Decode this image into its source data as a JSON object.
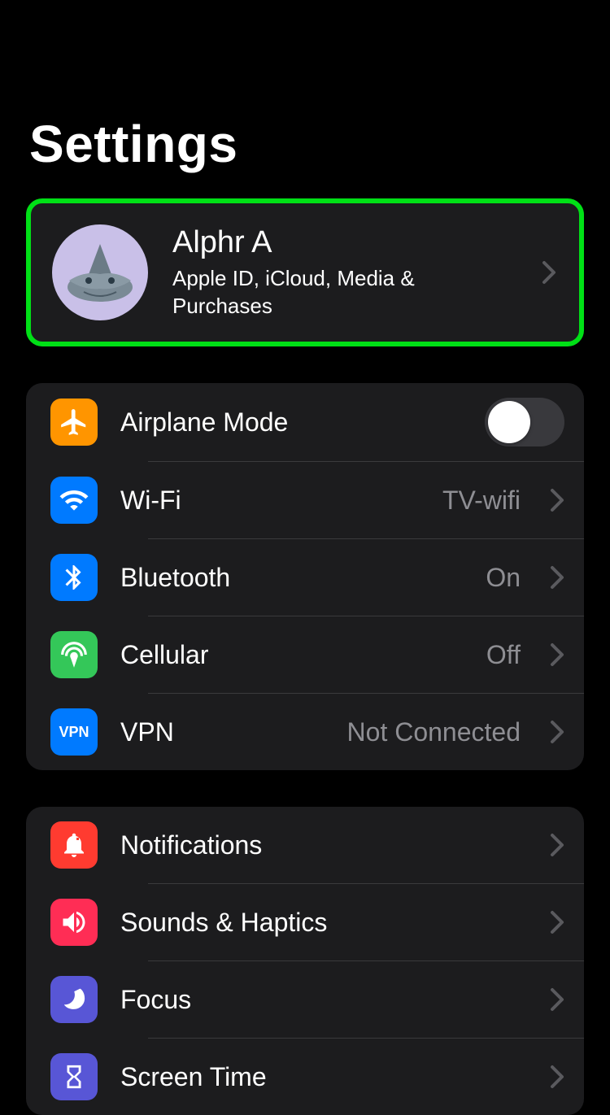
{
  "header": {
    "title": "Settings"
  },
  "account": {
    "name": "Alphr A",
    "subtitle": "Apple ID, iCloud, Media & Purchases",
    "highlighted": true
  },
  "groups": [
    {
      "items": [
        {
          "id": "airplane",
          "label": "Airplane Mode",
          "icon": "airplane-icon",
          "icon_color": "orange",
          "control": "toggle",
          "toggle_on": false
        },
        {
          "id": "wifi",
          "label": "Wi-Fi",
          "icon": "wifi-icon",
          "icon_color": "blue",
          "control": "disclosure",
          "value": "TV-wifi"
        },
        {
          "id": "bluetooth",
          "label": "Bluetooth",
          "icon": "bluetooth-icon",
          "icon_color": "blue",
          "control": "disclosure",
          "value": "On"
        },
        {
          "id": "cellular",
          "label": "Cellular",
          "icon": "cellular-icon",
          "icon_color": "green",
          "control": "disclosure",
          "value": "Off"
        },
        {
          "id": "vpn",
          "label": "VPN",
          "icon": "vpn-icon",
          "icon_color": "blue",
          "control": "disclosure",
          "value": "Not Connected"
        }
      ]
    },
    {
      "items": [
        {
          "id": "notifications",
          "label": "Notifications",
          "icon": "bell-icon",
          "icon_color": "red",
          "control": "disclosure",
          "value": ""
        },
        {
          "id": "sounds",
          "label": "Sounds & Haptics",
          "icon": "speaker-icon",
          "icon_color": "pink",
          "control": "disclosure",
          "value": ""
        },
        {
          "id": "focus",
          "label": "Focus",
          "icon": "moon-icon",
          "icon_color": "indigo",
          "control": "disclosure",
          "value": ""
        },
        {
          "id": "screentime",
          "label": "Screen Time",
          "icon": "hourglass-icon",
          "icon_color": "indigo",
          "control": "disclosure",
          "value": ""
        }
      ]
    }
  ]
}
